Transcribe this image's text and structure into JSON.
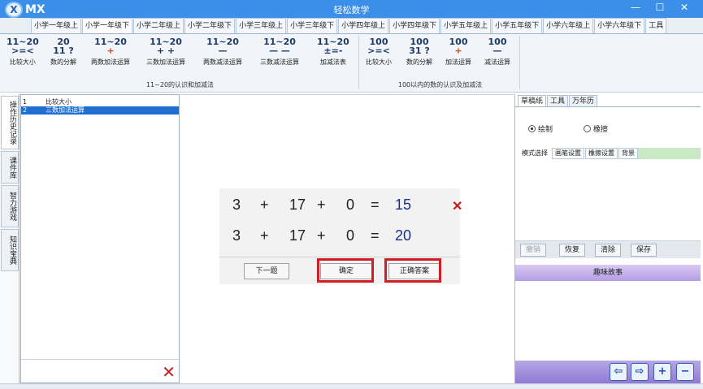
{
  "window": {
    "title": "轻松数学",
    "logo_text": "MX",
    "logo_badge": "X",
    "controls": [
      "—",
      "☐",
      "✕"
    ]
  },
  "tabs": [
    {
      "label": "小学一年级上",
      "active": false
    },
    {
      "label": "小学一年级下",
      "active": true
    },
    {
      "label": "小学二年级上",
      "active": false
    },
    {
      "label": "小学二年级下",
      "active": false
    },
    {
      "label": "小学三年级上",
      "active": false
    },
    {
      "label": "小学三年级下",
      "active": false
    },
    {
      "label": "小学四年级上",
      "active": false
    },
    {
      "label": "小学四年级下",
      "active": false
    },
    {
      "label": "小学五年级上",
      "active": false
    },
    {
      "label": "小学五年级下",
      "active": false
    },
    {
      "label": "小学六年级上",
      "active": false
    },
    {
      "label": "小学六年级下",
      "active": false
    },
    {
      "label": "工具",
      "active": false
    }
  ],
  "ribbon": {
    "group1": {
      "caption": "11~20的认识和加减法",
      "buttons": [
        {
          "icon_top": "11~20",
          "icon_bottom": ">=<",
          "label": "比较大小"
        },
        {
          "icon_top": "20",
          "icon_bottom": "11 ?",
          "label": "数的分解"
        },
        {
          "icon_top": "11~20",
          "icon_bottom": "+",
          "label": "两数加法运算"
        },
        {
          "icon_top": "11~20",
          "icon_bottom": "+ +",
          "label": "三数加法运算"
        },
        {
          "icon_top": "11~20",
          "icon_bottom": "—",
          "label": "两数减法运算"
        },
        {
          "icon_top": "11~20",
          "icon_bottom": "— —",
          "label": "三数减法运算"
        },
        {
          "icon_top": "11~20",
          "icon_bottom": "±=-",
          "label": "加减法表"
        }
      ]
    },
    "group2": {
      "caption": "100以内的数的认识及加减法",
      "buttons": [
        {
          "icon_top": "100",
          "icon_bottom": ">=<",
          "label": "比较大小"
        },
        {
          "icon_top": "100",
          "icon_bottom": "31 ?",
          "label": "数的分解"
        },
        {
          "icon_top": "100",
          "icon_bottom": "+",
          "label": "加法运算"
        },
        {
          "icon_top": "100",
          "icon_bottom": "—",
          "label": "减法运算"
        }
      ]
    }
  },
  "left_tabs": [
    "操作历史记录",
    "课件库",
    "智力游戏",
    "知识宝典"
  ],
  "history": [
    {
      "num": "1",
      "text": "比较大小",
      "selected": false
    },
    {
      "num": "2",
      "text": "三数加法运算",
      "selected": true
    }
  ],
  "quiz": {
    "row1": {
      "a": "3",
      "op1": "+",
      "b": "17",
      "op2": "+",
      "c": "0",
      "eq": "=",
      "answer": "15",
      "mark": "✕"
    },
    "row2": {
      "a": "3",
      "op1": "+",
      "b": "17",
      "op2": "+",
      "c": "0",
      "eq": "=",
      "answer": "20"
    },
    "next_label": "下一题",
    "confirm_label": "确定",
    "correct_label": "正确答案"
  },
  "right_panel": {
    "tabs": [
      "草稿纸",
      "工具",
      "万年历"
    ],
    "radio_draw": "绘制",
    "radio_erase": "橡擦",
    "subtabs": [
      "模式选择",
      "画笔设置",
      "橡擦设置",
      "背景"
    ],
    "buttons": [
      "撤销",
      "恢复",
      "清除",
      "保存"
    ],
    "story_title": "趣味故事"
  },
  "icons": {
    "clear": "✕",
    "prev": "⇦",
    "next": "⇨",
    "zoom_in": "+",
    "zoom_out": "−"
  },
  "colors": {
    "titlebar": "#3b8fe8",
    "answer_blue": "#1a2f8f",
    "error_red": "#c0201e",
    "highlight_red": "#d01e24",
    "selected_row": "#1e6fd0",
    "story_purple": "#b59de4"
  }
}
